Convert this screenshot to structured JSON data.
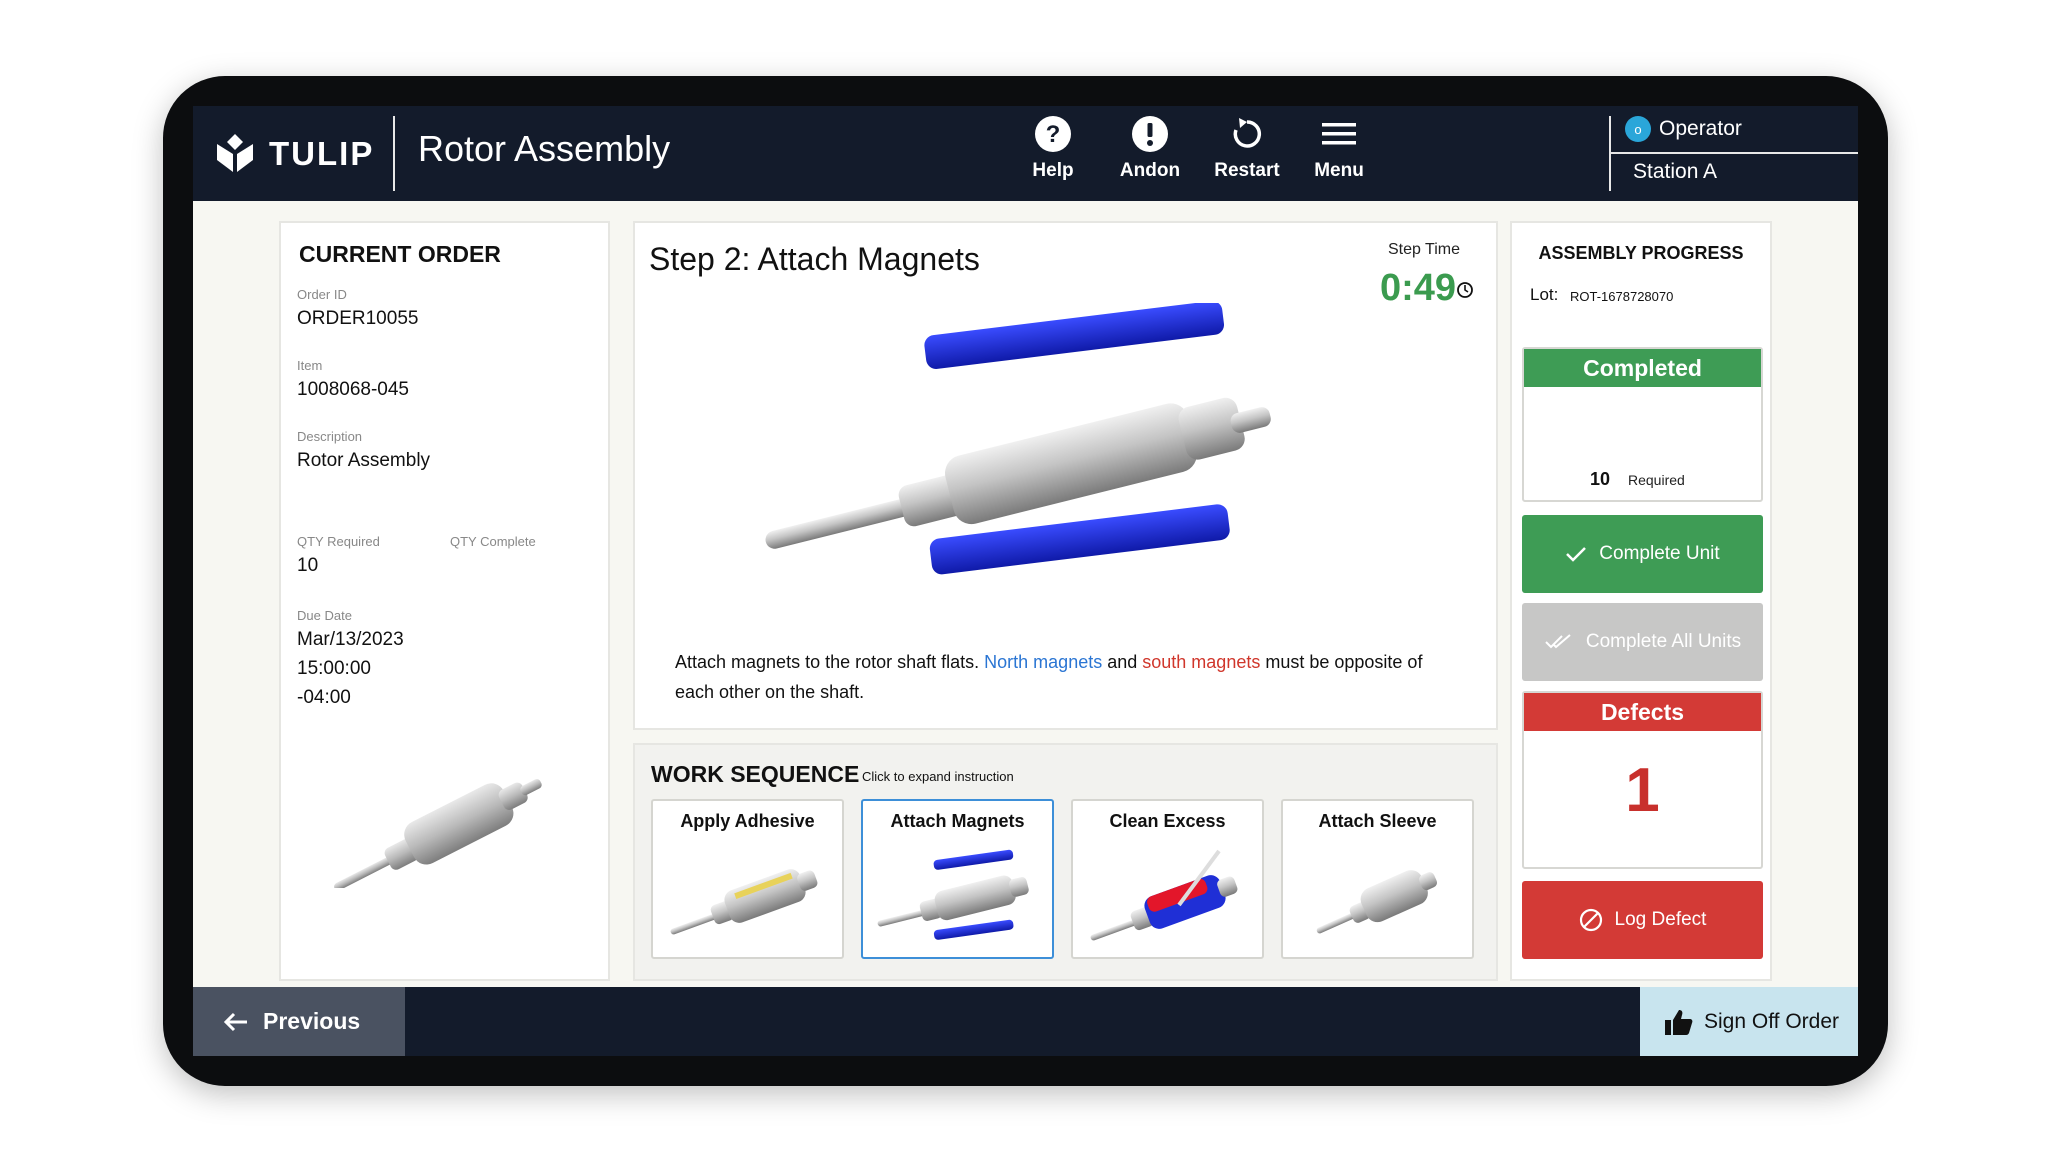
{
  "header": {
    "logo_text": "TULIP",
    "app_title": "Rotor Assembly",
    "buttons": [
      {
        "label": "Help",
        "icon": "help-icon"
      },
      {
        "label": "Andon",
        "icon": "alert-icon"
      },
      {
        "label": "Restart",
        "icon": "restart-icon"
      },
      {
        "label": "Menu",
        "icon": "menu-icon"
      }
    ],
    "operator_initial": "o",
    "operator": "Operator",
    "station": "Station A"
  },
  "order": {
    "title": "CURRENT ORDER",
    "order_id_label": "Order ID",
    "order_id": "ORDER10055",
    "item_label": "Item",
    "item": "1008068-045",
    "description_label": "Description",
    "description": "Rotor Assembly",
    "qty_required_label": "QTY Required",
    "qty_required": "10",
    "qty_complete_label": "QTY Complete",
    "due_date_label": "Due Date",
    "due_date": "Mar/13/2023",
    "due_time": "15:00:00",
    "due_tz": "-04:00"
  },
  "step": {
    "title": "Step 2: Attach Magnets",
    "time_label": "Step Time",
    "time": "0:49",
    "text_a": "Attach magnets to the rotor shaft flats. ",
    "text_north": "North magnets",
    "text_b": " and ",
    "text_south": "south magnets",
    "text_c": " must be opposite of each other on the shaft.",
    "colors": {
      "north": "#2a75d3",
      "south": "#d0362b",
      "magnet": "#1f2fd6"
    }
  },
  "sequence": {
    "title": "WORK SEQUENCE",
    "hint": "Click to expand instruction",
    "items": [
      {
        "label": "Apply Adhesive"
      },
      {
        "label": "Attach Magnets"
      },
      {
        "label": "Clean Excess"
      },
      {
        "label": "Attach Sleeve"
      }
    ],
    "active_index": 1
  },
  "progress": {
    "title": "ASSEMBLY PROGRESS",
    "lot_label": "Lot:",
    "lot": "ROT-1678728070",
    "completed_label": "Completed",
    "required_num": "10",
    "required_label": "Required",
    "complete_unit": "Complete Unit",
    "complete_all": "Complete All Units",
    "defects_label": "Defects",
    "defects_count": "1",
    "log_defect": "Log Defect",
    "colors": {
      "green": "#3e9c55",
      "red": "#d33a36",
      "disabled": "#c7c7c6"
    }
  },
  "footer": {
    "previous": "Previous",
    "sign_off": "Sign Off Order"
  }
}
